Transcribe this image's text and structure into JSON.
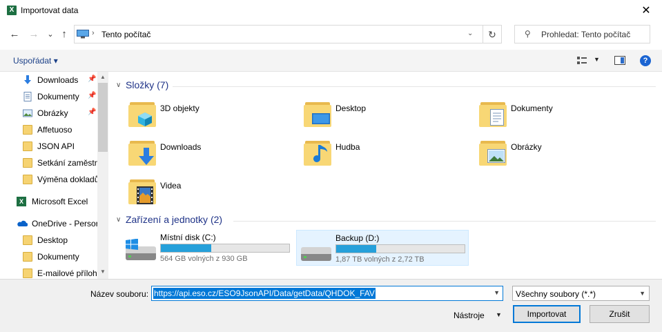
{
  "window": {
    "title": "Importovat data",
    "app_icon": "excel-icon",
    "close": "✕"
  },
  "nav": {
    "back": "←",
    "forward": "→",
    "recent": "⌄",
    "up": "↑",
    "address_sep": "›",
    "address": "Tento počítač",
    "address_dd": "⌄",
    "refresh": "↻",
    "search_placeholder": "Prohledat: Tento počítač",
    "search_glyph": "⚲"
  },
  "toolbar": {
    "organize": "Uspořádat ▾",
    "view_dd": "▼",
    "help": "?"
  },
  "sidebar": {
    "items": [
      {
        "label": "Downloads",
        "pin": "📌",
        "icon": "downloads-icon"
      },
      {
        "label": "Dokumenty",
        "pin": "📌",
        "icon": "document-icon"
      },
      {
        "label": "Obrázky",
        "pin": "📌",
        "icon": "pictures-icon"
      },
      {
        "label": "Affetuoso",
        "icon": "folder-icon"
      },
      {
        "label": "JSON API",
        "icon": "folder-icon"
      },
      {
        "label": "Setkání zaměstn",
        "icon": "folder-icon"
      },
      {
        "label": "Výměna dokladů",
        "icon": "folder-icon"
      },
      {
        "label": "Microsoft Excel",
        "icon": "excel-icon"
      },
      {
        "label": "OneDrive - Persor",
        "icon": "onedrive-icon"
      },
      {
        "label": "Desktop",
        "icon": "folder-icon"
      },
      {
        "label": "Dokumenty",
        "icon": "folder-icon"
      },
      {
        "label": "E-mailové přílohy",
        "icon": "folder-icon"
      }
    ],
    "scroll_up": "▲",
    "scroll_down": "▼"
  },
  "content": {
    "chevron": "∨",
    "folders_header": "Složky (7)",
    "folders": [
      {
        "name": "3D objekty",
        "icon": "3d-objects-icon"
      },
      {
        "name": "Desktop",
        "icon": "desktop-icon"
      },
      {
        "name": "Dokumenty",
        "icon": "documents-icon"
      },
      {
        "name": "Downloads",
        "icon": "downloads-icon"
      },
      {
        "name": "Hudba",
        "icon": "music-icon"
      },
      {
        "name": "Obrázky",
        "icon": "pictures-icon"
      },
      {
        "name": "Videa",
        "icon": "videos-icon"
      }
    ],
    "drives_header": "Zařízení a jednotky (2)",
    "drives": [
      {
        "name": "Místní disk (C:)",
        "free": "564 GB volných z 930 GB",
        "used_fraction": 0.39,
        "icon": "windows-drive-icon"
      },
      {
        "name": "Backup (D:)",
        "free": "1,87 TB volných z 2,72 TB",
        "used_fraction": 0.31,
        "icon": "hard-drive-icon"
      }
    ]
  },
  "bottom": {
    "filename_label": "Název souboru:",
    "filename_value": "https://api.eso.cz/ESO9JsonAPI/Data/getData/QHDOK_FAV",
    "filetype": "Všechny soubory (*.*)",
    "tools": "Nástroje",
    "dd": "▼",
    "import": "Importovat",
    "cancel": "Zrušit"
  },
  "colors": {
    "accent": "#0078d7",
    "folder": "#f8d775",
    "group_heading": "#1e3287",
    "drive_fill": "#26a0da"
  }
}
